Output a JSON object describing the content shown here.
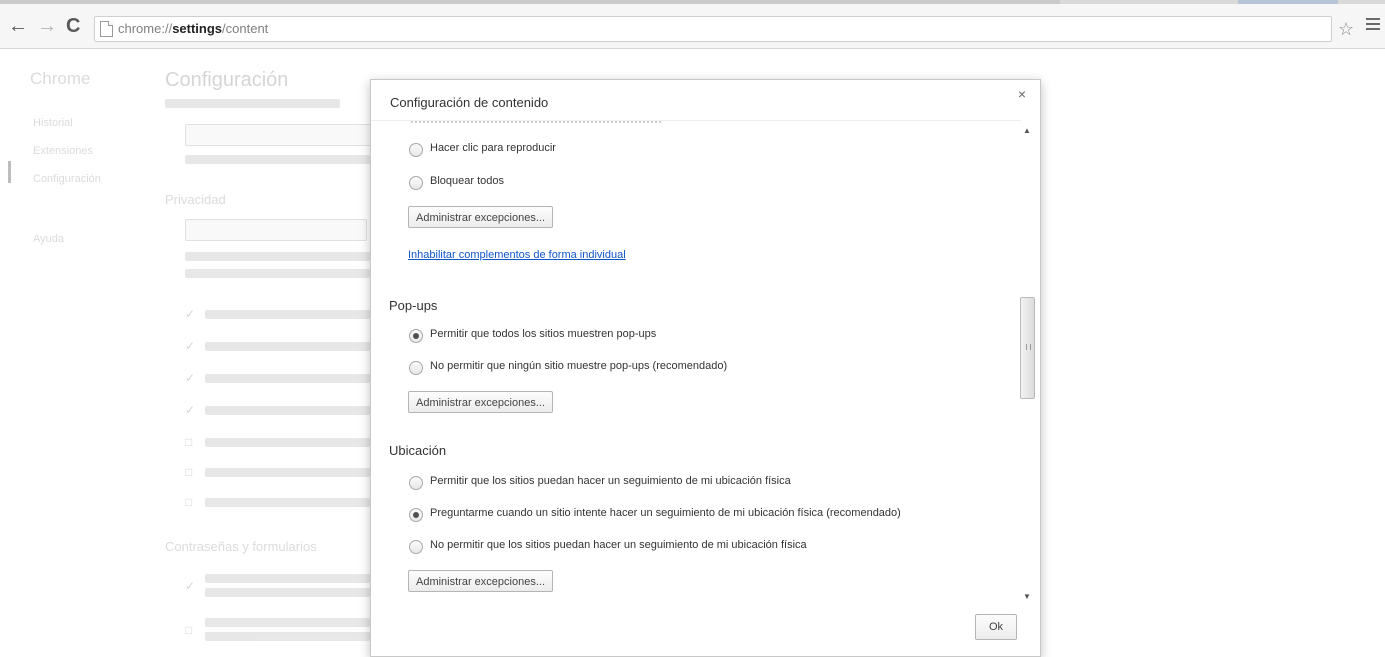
{
  "browser": {
    "url_prefix": "chrome://",
    "url_bold": "settings",
    "url_suffix": "/content"
  },
  "background": {
    "sidebar_title": "Chrome",
    "sidebar_items": [
      "Historial",
      "Extensiones",
      "Configuración",
      "Ayuda"
    ],
    "page_title": "Configuración",
    "sections": [
      "Privacidad",
      "Contraseñas y formularios"
    ]
  },
  "dialog": {
    "title": "Configuración de contenido",
    "plugins": {
      "options": [
        {
          "label": "Hacer clic para reproducir",
          "checked": false
        },
        {
          "label": "Bloquear todos",
          "checked": false
        }
      ],
      "exceptions_button": "Administrar excepciones...",
      "link": "Inhabilitar complementos de forma individual"
    },
    "popups": {
      "heading": "Pop-ups",
      "options": [
        {
          "label": "Permitir que todos los sitios muestren pop-ups",
          "checked": true
        },
        {
          "label": "No permitir que ningún sitio muestre pop-ups (recomendado)",
          "checked": false
        }
      ],
      "exceptions_button": "Administrar excepciones..."
    },
    "location": {
      "heading": "Ubicación",
      "options": [
        {
          "label": "Permitir que los sitios puedan hacer un seguimiento de mi ubicación física",
          "checked": false
        },
        {
          "label": "Preguntarme cuando un sitio intente hacer un seguimiento de mi ubicación física (recomendado)",
          "checked": true
        },
        {
          "label": "No permitir que los sitios puedan hacer un seguimiento de mi ubicación física",
          "checked": false
        }
      ],
      "exceptions_button": "Administrar excepciones..."
    },
    "ok_button": "Ok",
    "close_symbol": "×"
  },
  "icons": {
    "back": "back-arrow-icon",
    "forward": "forward-arrow-icon",
    "reload": "reload-icon",
    "page": "page-icon",
    "star": "star-icon",
    "menu": "menu-icon"
  }
}
